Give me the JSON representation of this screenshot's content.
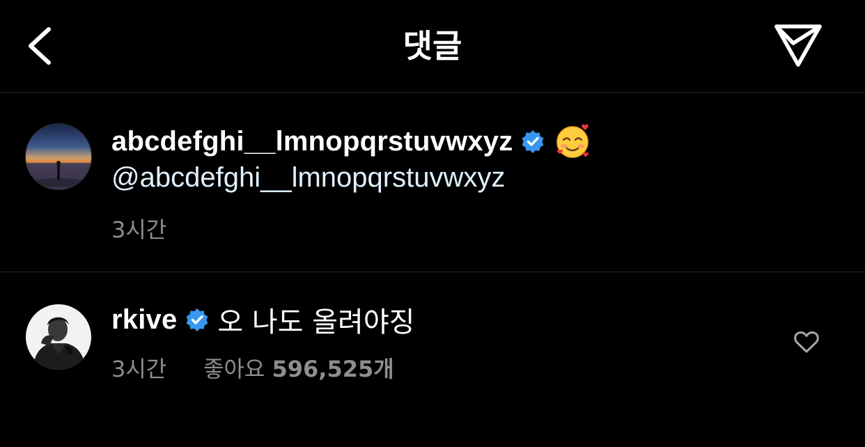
{
  "header": {
    "title": "댓글",
    "back_icon": "chevron-left-icon",
    "send_icon": "paper-plane-icon"
  },
  "caption": {
    "username": "abcdefghi__lmnopqrstuvwxyz",
    "verified": true,
    "emoji": "🥰",
    "mention": "@abcdefghi__lmnopqrstuvwxyz",
    "time": "3시간"
  },
  "comment": {
    "username": "rkive",
    "verified": true,
    "text": "오 나도 올려야징",
    "time": "3시간",
    "likes_label": "좋아요",
    "likes_count": "596,525개",
    "like_icon": "heart-outline-icon"
  },
  "colors": {
    "background": "#000000",
    "text": "#ffffff",
    "meta": "#8e8e8e",
    "mention": "#e0f1ff",
    "verified": "#3897f0",
    "divider": "#262626"
  }
}
